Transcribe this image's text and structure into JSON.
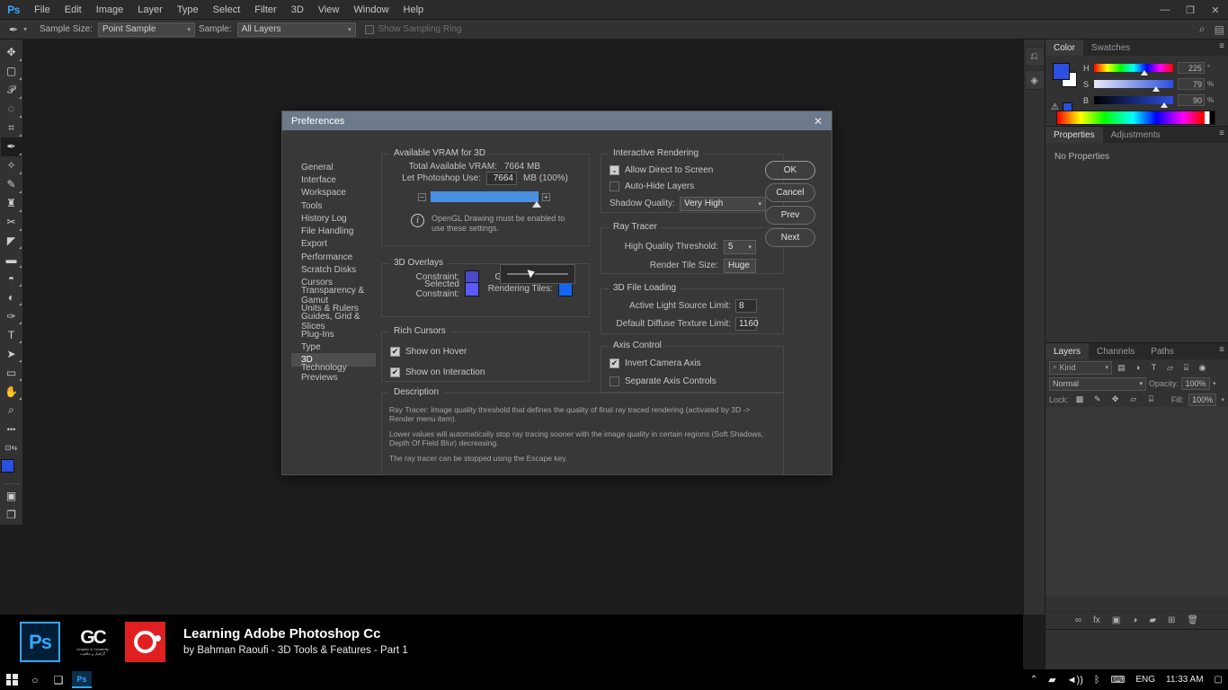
{
  "menubar": {
    "logo": "Ps",
    "items": [
      "File",
      "Edit",
      "Image",
      "Layer",
      "Type",
      "Select",
      "Filter",
      "3D",
      "View",
      "Window",
      "Help"
    ],
    "window_controls": {
      "minimize": "—",
      "maximize": "❐",
      "close": "✕"
    }
  },
  "optionsbar": {
    "tool_icon": "eyedropper-icon",
    "sample_size_label": "Sample Size:",
    "sample_size_value": "Point Sample",
    "sample_label": "Sample:",
    "sample_value": "All Layers",
    "show_sampling_ring": "Show Sampling Ring"
  },
  "toolbar": {
    "tools": [
      {
        "name": "move-tool",
        "glyph": "✥"
      },
      {
        "name": "marquee-tool",
        "glyph": "▢"
      },
      {
        "name": "lasso-tool",
        "glyph": "𝒫"
      },
      {
        "name": "quick-selection-tool",
        "glyph": "◌"
      },
      {
        "name": "crop-tool",
        "glyph": "⌗"
      },
      {
        "name": "eyedropper-tool",
        "glyph": "✒"
      },
      {
        "name": "spot-healing-tool",
        "glyph": "✧"
      },
      {
        "name": "brush-tool",
        "glyph": "✎"
      },
      {
        "name": "clone-stamp-tool",
        "glyph": "♜"
      },
      {
        "name": "history-brush-tool",
        "glyph": "✂"
      },
      {
        "name": "eraser-tool",
        "glyph": "◤"
      },
      {
        "name": "gradient-tool",
        "glyph": "▬"
      },
      {
        "name": "blur-tool",
        "glyph": "💧"
      },
      {
        "name": "dodge-tool",
        "glyph": "◐"
      },
      {
        "name": "pen-tool",
        "glyph": "✑"
      },
      {
        "name": "type-tool",
        "glyph": "T"
      },
      {
        "name": "path-selection-tool",
        "glyph": "➤"
      },
      {
        "name": "rectangle-tool",
        "glyph": "▭"
      },
      {
        "name": "hand-tool",
        "glyph": "✋"
      },
      {
        "name": "zoom-tool",
        "glyph": "🔍"
      },
      {
        "name": "more-tools",
        "glyph": "•••"
      }
    ],
    "quickmask_glyph": "▣",
    "screenmode_glyph": "❐"
  },
  "rail": {
    "buttons": [
      {
        "name": "history-panel-icon",
        "glyph": "⎌"
      },
      {
        "name": "actions-panel-icon",
        "glyph": "◈"
      }
    ],
    "cc_badge": "◉"
  },
  "color_panel": {
    "tabs": [
      {
        "label": "Color",
        "active": true
      },
      {
        "label": "Swatches",
        "active": false
      }
    ],
    "menu_glyph": "≡",
    "foreground_color": "#2b4fe0",
    "background_color": "#ffffff",
    "sliders": [
      {
        "label": "H",
        "value": "225",
        "unit": "°",
        "thumb_pct": 62
      },
      {
        "label": "S",
        "value": "79",
        "unit": "%",
        "thumb_pct": 78
      },
      {
        "label": "B",
        "value": "90",
        "unit": "%",
        "thumb_pct": 89
      }
    ]
  },
  "properties_panel": {
    "tabs": [
      {
        "label": "Properties",
        "active": true
      },
      {
        "label": "Adjustments",
        "active": false
      }
    ],
    "menu_glyph": "≡",
    "empty_text": "No Properties"
  },
  "layers_panel": {
    "tabs": [
      {
        "label": "Layers",
        "active": true
      },
      {
        "label": "Channels",
        "active": false
      },
      {
        "label": "Paths",
        "active": false
      }
    ],
    "menu_glyph": "≡",
    "filter_label": "Kind",
    "filter_icons": [
      {
        "name": "filter-pixel-icon",
        "glyph": "▤"
      },
      {
        "name": "filter-adjustment-icon",
        "glyph": "◑"
      },
      {
        "name": "filter-type-icon",
        "glyph": "T"
      },
      {
        "name": "filter-shape-icon",
        "glyph": "▱"
      },
      {
        "name": "filter-smart-icon",
        "glyph": "🔒"
      }
    ],
    "toggle_glyph": "◉",
    "blend_mode": "Normal",
    "opacity_label": "Opacity:",
    "opacity_value": "100%",
    "lock_label": "Lock:",
    "lock_icons": [
      {
        "name": "lock-transparent-icon",
        "glyph": "▩"
      },
      {
        "name": "lock-image-icon",
        "glyph": "✎"
      },
      {
        "name": "lock-position-icon",
        "glyph": "✥"
      },
      {
        "name": "lock-artboard-icon",
        "glyph": "▱"
      },
      {
        "name": "lock-all-icon",
        "glyph": "🔒"
      }
    ],
    "fill_label": "Fill:",
    "fill_value": "100%",
    "footer_icons": [
      {
        "name": "link-layers-icon",
        "glyph": "∞"
      },
      {
        "name": "layer-style-icon",
        "glyph": "fx"
      },
      {
        "name": "layer-mask-icon",
        "glyph": "▣"
      },
      {
        "name": "adjustment-layer-icon",
        "glyph": "◑"
      },
      {
        "name": "new-group-icon",
        "glyph": "▰"
      },
      {
        "name": "new-layer-icon",
        "glyph": "⊞"
      },
      {
        "name": "delete-layer-icon",
        "glyph": "🗑"
      }
    ]
  },
  "dialog": {
    "title": "Preferences",
    "close_glyph": "✕",
    "nav_items": [
      "General",
      "Interface",
      "Workspace",
      "Tools",
      "History Log",
      "File Handling",
      "Export",
      "Performance",
      "Scratch Disks",
      "Cursors",
      "Transparency & Gamut",
      "Units & Rulers",
      "Guides, Grid & Slices",
      "Plug-Ins",
      "Type",
      "3D",
      "Technology Previews"
    ],
    "active_nav": "3D",
    "buttons": [
      {
        "label": "OK",
        "name": "ok-button",
        "primary": true
      },
      {
        "label": "Cancel",
        "name": "cancel-button",
        "primary": false
      },
      {
        "label": "Prev",
        "name": "prev-button",
        "primary": false
      },
      {
        "label": "Next",
        "name": "next-button",
        "primary": false
      }
    ],
    "vram": {
      "group_title": "Available VRAM for 3D",
      "total_label": "Total Available VRAM:",
      "total_value": "7664 MB",
      "use_label": "Let Photoshop Use:",
      "use_value": "7664",
      "use_suffix": "MB (100%)",
      "minus_glyph": "−",
      "plus_glyph": "+",
      "info_glyph": "i",
      "info_text": "OpenGL Drawing must be enabled to use these settings."
    },
    "overlays": {
      "group_title": "3D Overlays",
      "constraint_label": "Constraint:",
      "constraint_color": "#4b4bc8",
      "ground_plane_label": "Ground Plane:",
      "ground_plane_color": "#000000",
      "selected_constraint_label": "Selected Constraint:",
      "selected_constraint_color": "#5a5aff",
      "rendering_tiles_label": "Rendering Tiles:",
      "rendering_tiles_color": "#1467f5"
    },
    "rich_cursors": {
      "group_title": "Rich Cursors",
      "show_on_hover": "Show on Hover",
      "show_on_hover_checked": true,
      "show_on_interaction": "Show on Interaction",
      "show_on_interaction_checked": true,
      "check_glyph": "✔"
    },
    "interactive_rendering": {
      "group_title": "Interactive Rendering",
      "allow_direct_label": "Allow Direct to Screen",
      "allow_direct_checked": true,
      "auto_hide_label": "Auto-Hide Layers",
      "auto_hide_checked": false,
      "shadow_quality_label": "Shadow Quality:",
      "shadow_quality_value": "Very High",
      "caret_glyph": "⌄"
    },
    "ray_tracer": {
      "group_title": "Ray Tracer",
      "threshold_label": "High Quality Threshold:",
      "threshold_value": "5",
      "tile_size_label": "Render Tile Size:",
      "tile_size_value": "Huge",
      "caret_glyph": "⌄"
    },
    "file_loading": {
      "group_title": "3D File Loading",
      "light_limit_label": "Active Light Source Limit:",
      "light_limit_value": "8",
      "texture_limit_label": "Default Diffuse Texture Limit:",
      "texture_limit_value": "1160"
    },
    "axis_control": {
      "group_title": "Axis Control",
      "invert_label": "Invert Camera Axis",
      "invert_checked": true,
      "separate_label": "Separate Axis Controls",
      "separate_checked": false,
      "check_glyph": "✔"
    },
    "description": {
      "group_title": "Description",
      "paragraphs": [
        "Ray Tracer: Image quality threshold that defines the quality of final ray traced rendering (activated by 3D -> Render menu item).",
        "Lower values will automatically stop ray tracing sooner with the image quality in certain regions (Soft Shadows, Depth Of Field Blur) decreasing.",
        "The ray tracer can be stopped using the Escape key."
      ]
    }
  },
  "branding": {
    "ps_logo": "Ps",
    "gc_logo": "GC",
    "gc_sub": "Graphic & Creativity",
    "gc_sub2": "گرافیک و خلاقیت",
    "title": "Learning Adobe Photoshop Cc",
    "subtitle": "by Bahman Raoufi - 3D Tools & Features - Part 1"
  },
  "taskbar": {
    "start_icon": "windows-icon",
    "search_icon": "○",
    "taskview_icon": "❑",
    "ps_icon": "Ps",
    "tray": {
      "chevron": "⌃",
      "network": "📶",
      "volume": "🔊",
      "bluetooth": "ᛒ",
      "keyboard": "⌨",
      "language": "ENG",
      "time": "11:33 AM",
      "notifications": "▢"
    }
  }
}
